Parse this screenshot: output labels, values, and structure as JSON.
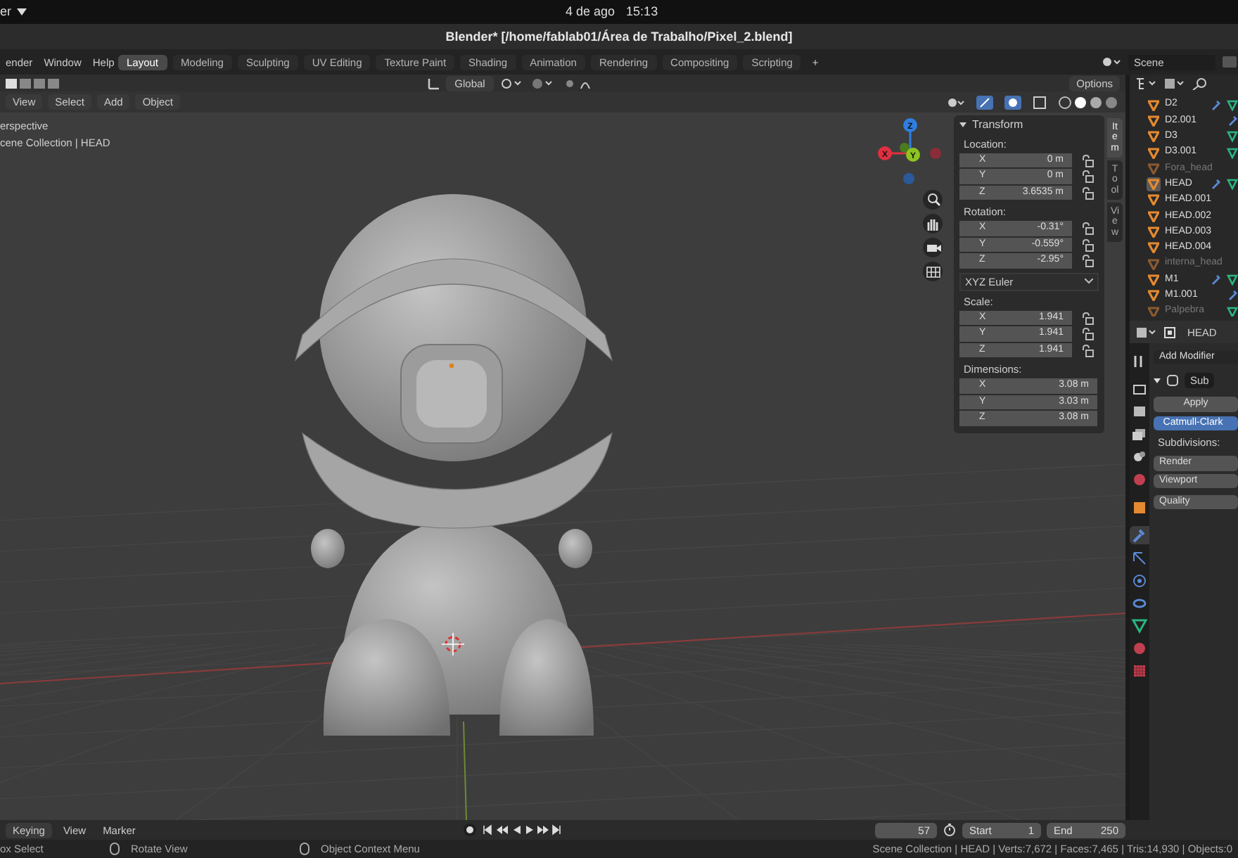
{
  "top_bar": {
    "app_menu": "er",
    "date": "4 de ago",
    "time": "15:13"
  },
  "window": {
    "title": "Blender* [/home/fablab01/Área de Trabalho/Pixel_2.blend]"
  },
  "menus": [
    "ender",
    "Window",
    "Help"
  ],
  "workspaces": [
    {
      "label": "Layout",
      "selected": true
    },
    {
      "label": "Modeling",
      "selected": false
    },
    {
      "label": "Sculpting",
      "selected": false
    },
    {
      "label": "UV Editing",
      "selected": false
    },
    {
      "label": "Texture Paint",
      "selected": false
    },
    {
      "label": "Shading",
      "selected": false
    },
    {
      "label": "Animation",
      "selected": false
    },
    {
      "label": "Rendering",
      "selected": false
    },
    {
      "label": "Compositing",
      "selected": false
    },
    {
      "label": "Scripting",
      "selected": false
    }
  ],
  "add_workspace": "+",
  "scene": "Scene",
  "tool_header": {
    "orientation": "Global",
    "options": "Options"
  },
  "viewport_header": {
    "menus": [
      "View",
      "Select",
      "Add",
      "Object"
    ]
  },
  "viewport": {
    "view_name": "erspective",
    "collection": "cene Collection | HEAD",
    "gizmo": {
      "z": "Z",
      "x": "X",
      "y": "Y"
    }
  },
  "n_panel": {
    "title": "Transform",
    "tabs": [
      {
        "label": "Item",
        "selected": true
      },
      {
        "label": "Tool",
        "selected": false
      },
      {
        "label": "View",
        "selected": false
      }
    ],
    "sections": [
      {
        "label": "Location:",
        "lockable": true,
        "fields": [
          {
            "axis": "X",
            "value": "0 m"
          },
          {
            "axis": "Y",
            "value": "0 m"
          },
          {
            "axis": "Z",
            "value": "3.6535 m"
          }
        ]
      },
      {
        "label": "Rotation:",
        "lockable": true,
        "fields": [
          {
            "axis": "X",
            "value": "-0.31°"
          },
          {
            "axis": "Y",
            "value": "-0.559°"
          },
          {
            "axis": "Z",
            "value": "-2.95°"
          }
        ],
        "mode": "XYZ Euler"
      },
      {
        "label": "Scale:",
        "lockable": true,
        "fields": [
          {
            "axis": "X",
            "value": "1.941"
          },
          {
            "axis": "Y",
            "value": "1.941"
          },
          {
            "axis": "Z",
            "value": "1.941"
          }
        ]
      },
      {
        "label": "Dimensions:",
        "lockable": false,
        "fields": [
          {
            "axis": "X",
            "value": "3.08 m"
          },
          {
            "axis": "Y",
            "value": "3.03 m"
          },
          {
            "axis": "Z",
            "value": "3.08 m"
          }
        ]
      }
    ]
  },
  "outliner": {
    "items": [
      {
        "name": "D2",
        "hidden": false,
        "selected": false,
        "modifier": true,
        "mesh_data": true
      },
      {
        "name": "D2.001",
        "hidden": false,
        "selected": false,
        "modifier": true,
        "mesh_data": false
      },
      {
        "name": "D3",
        "hidden": false,
        "selected": false,
        "modifier": false,
        "mesh_data": true
      },
      {
        "name": "D3.001",
        "hidden": false,
        "selected": false,
        "modifier": false,
        "mesh_data": true
      },
      {
        "name": "Fora_head",
        "hidden": true,
        "selected": false,
        "modifier": false,
        "mesh_data": false
      },
      {
        "name": "HEAD",
        "hidden": false,
        "selected": true,
        "modifier": true,
        "mesh_data": true
      },
      {
        "name": "HEAD.001",
        "hidden": false,
        "selected": false,
        "modifier": false,
        "mesh_data": false
      },
      {
        "name": "HEAD.002",
        "hidden": false,
        "selected": false,
        "modifier": false,
        "mesh_data": false
      },
      {
        "name": "HEAD.003",
        "hidden": false,
        "selected": false,
        "modifier": false,
        "mesh_data": false
      },
      {
        "name": "HEAD.004",
        "hidden": false,
        "selected": false,
        "modifier": false,
        "mesh_data": false
      },
      {
        "name": "interna_head",
        "hidden": true,
        "selected": false,
        "modifier": false,
        "mesh_data": false
      },
      {
        "name": "M1",
        "hidden": false,
        "selected": false,
        "modifier": true,
        "mesh_data": true
      },
      {
        "name": "M1.001",
        "hidden": false,
        "selected": false,
        "modifier": true,
        "mesh_data": false
      },
      {
        "name": "Palpebra",
        "hidden": true,
        "selected": false,
        "modifier": false,
        "mesh_data": true
      }
    ]
  },
  "properties": {
    "object": "HEAD",
    "tabs": [
      {
        "kind": "tool",
        "selected": false
      },
      {
        "kind": "render",
        "selected": false
      },
      {
        "kind": "output",
        "selected": false
      },
      {
        "kind": "viewlayer",
        "selected": false
      },
      {
        "kind": "scene",
        "selected": false
      },
      {
        "kind": "world",
        "selected": false
      },
      {
        "kind": "object",
        "selected": false
      },
      {
        "kind": "modifier",
        "selected": true
      },
      {
        "kind": "particles",
        "selected": false
      },
      {
        "kind": "physics",
        "selected": false
      },
      {
        "kind": "constraints",
        "selected": false
      },
      {
        "kind": "data",
        "selected": false
      },
      {
        "kind": "material",
        "selected": false
      },
      {
        "kind": "texture",
        "selected": false
      }
    ],
    "add_modifier": "Add Modifier",
    "modifier_name": "Sub",
    "apply": "Apply",
    "type": "Catmull-Clark",
    "subdivisions_label": "Subdivisions:",
    "levels": [
      "Render",
      "Viewport"
    ],
    "quality": "Quality"
  },
  "timeline": {
    "menus": [
      "Keying",
      "View",
      "Marker"
    ],
    "frame": "57",
    "start_label": "Start",
    "start": "1",
    "end_label": "End",
    "end": "250"
  },
  "status_bar": {
    "hints": [
      "ox Select",
      "Rotate View",
      "Object Context Menu"
    ],
    "stats": "Scene Collection | HEAD | Verts:7,672 | Faces:7,465 | Tris:14,930 | Objects:0"
  }
}
